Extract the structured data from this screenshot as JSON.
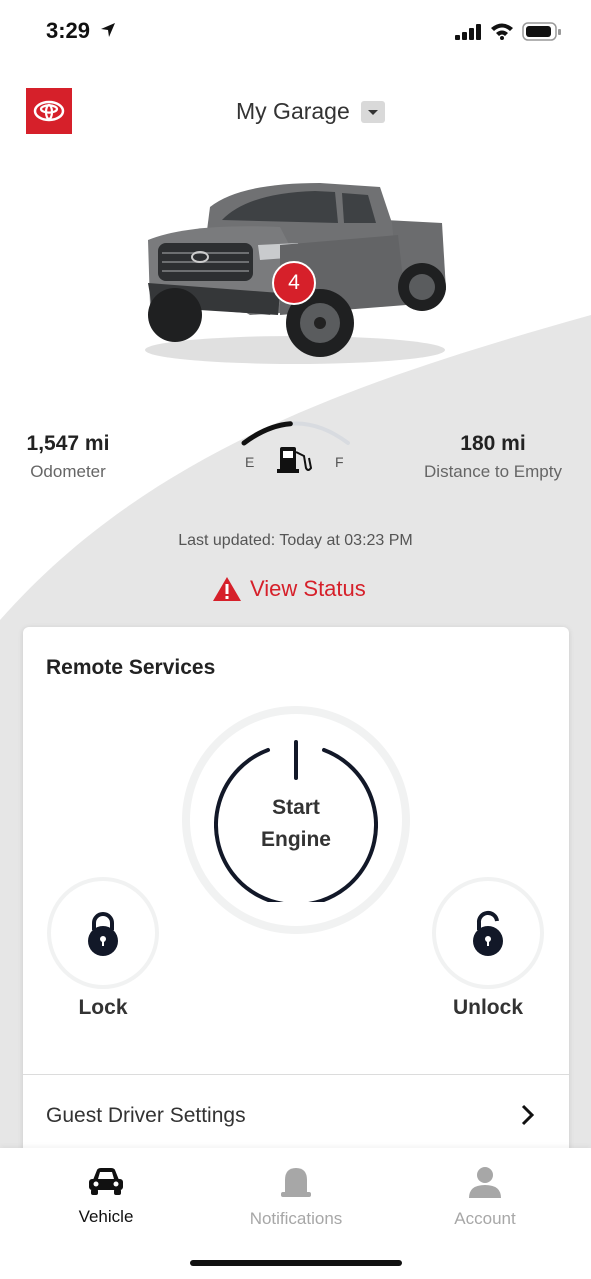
{
  "status_bar": {
    "time": "3:29"
  },
  "header": {
    "title": "My Garage"
  },
  "vehicle": {
    "notification_count": "4"
  },
  "stats": {
    "odometer_value": "1,547 mi",
    "odometer_label": "Odometer",
    "range_value": "180 mi",
    "range_label": "Distance to Empty",
    "fuel_empty_label": "E",
    "fuel_full_label": "F",
    "fuel_level": 0.45
  },
  "last_updated": "Last updated:  Today at 03:23 PM",
  "view_status_label": "View Status",
  "remote_services": {
    "title": "Remote Services",
    "start_line1": "Start",
    "start_line2": "Engine",
    "lock_label": "Lock",
    "unlock_label": "Unlock"
  },
  "guest_driver_label": "Guest Driver Settings",
  "tabs": [
    {
      "label": "Vehicle",
      "icon": "car-icon",
      "active": true
    },
    {
      "label": "Notifications",
      "icon": "bell-icon",
      "active": false
    },
    {
      "label": "Account",
      "icon": "person-icon",
      "active": false
    }
  ],
  "colors": {
    "accent": "#d6202a",
    "inactive": "#a7a7a7",
    "background_swoop": "#e6e6e6"
  }
}
